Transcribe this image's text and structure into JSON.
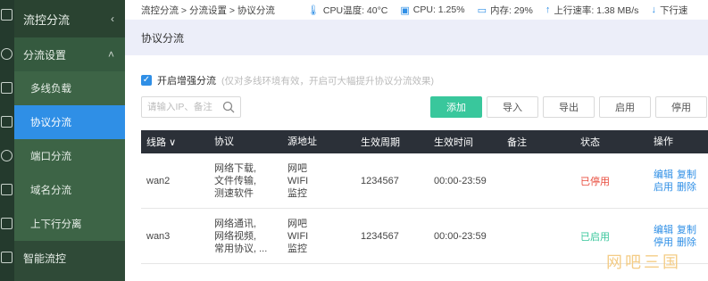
{
  "sidebar": {
    "header": "流控分流",
    "group": "分流设置",
    "items": [
      {
        "label": "多线负载"
      },
      {
        "label": "协议分流"
      },
      {
        "label": "端口分流"
      },
      {
        "label": "域名分流"
      },
      {
        "label": "上下行分离"
      }
    ],
    "bottom": "智能流控"
  },
  "breadcrumb": "流控分流 > 分流设置 > 协议分流",
  "status": {
    "cpu_temp": "CPU温度: 40°C",
    "cpu": "CPU: 1.25%",
    "mem": "内存: 29%",
    "up": "上行速率: 1.38 MB/s",
    "down": "下行速"
  },
  "page_title": "协议分流",
  "option": {
    "label": "开启增强分流",
    "hint": "(仅对多线环境有效，开启可大幅提升协议分流效果)"
  },
  "search": {
    "placeholder": "请输入IP、备注",
    "value": ""
  },
  "buttons": {
    "add": "添加",
    "import": "导入",
    "export": "导出",
    "enable": "启用",
    "disable": "停用"
  },
  "table": {
    "headers": [
      "线路",
      "协议",
      "源地址",
      "生效周期",
      "生效时间",
      "备注",
      "状态",
      "操作"
    ],
    "rows": [
      {
        "line": "wan2",
        "protocol": [
          "网络下载,",
          "文件传输,",
          "测速软件"
        ],
        "source": [
          "网吧",
          "WIFI",
          "监控"
        ],
        "period": "1234567",
        "time": "00:00-23:59",
        "note": "",
        "status": "已停用",
        "ops": [
          "编辑",
          "复制",
          "启用",
          "删除"
        ]
      },
      {
        "line": "wan3",
        "protocol": [
          "网络通讯,",
          "网络视频,",
          "常用协议, ..."
        ],
        "source": [
          "网吧",
          "WIFI",
          "监控"
        ],
        "period": "1234567",
        "time": "00:00-23:59",
        "note": "",
        "status": "已启用",
        "ops": [
          "编辑",
          "复制",
          "停用",
          "删除"
        ]
      }
    ]
  },
  "watermark": "网吧三国"
}
